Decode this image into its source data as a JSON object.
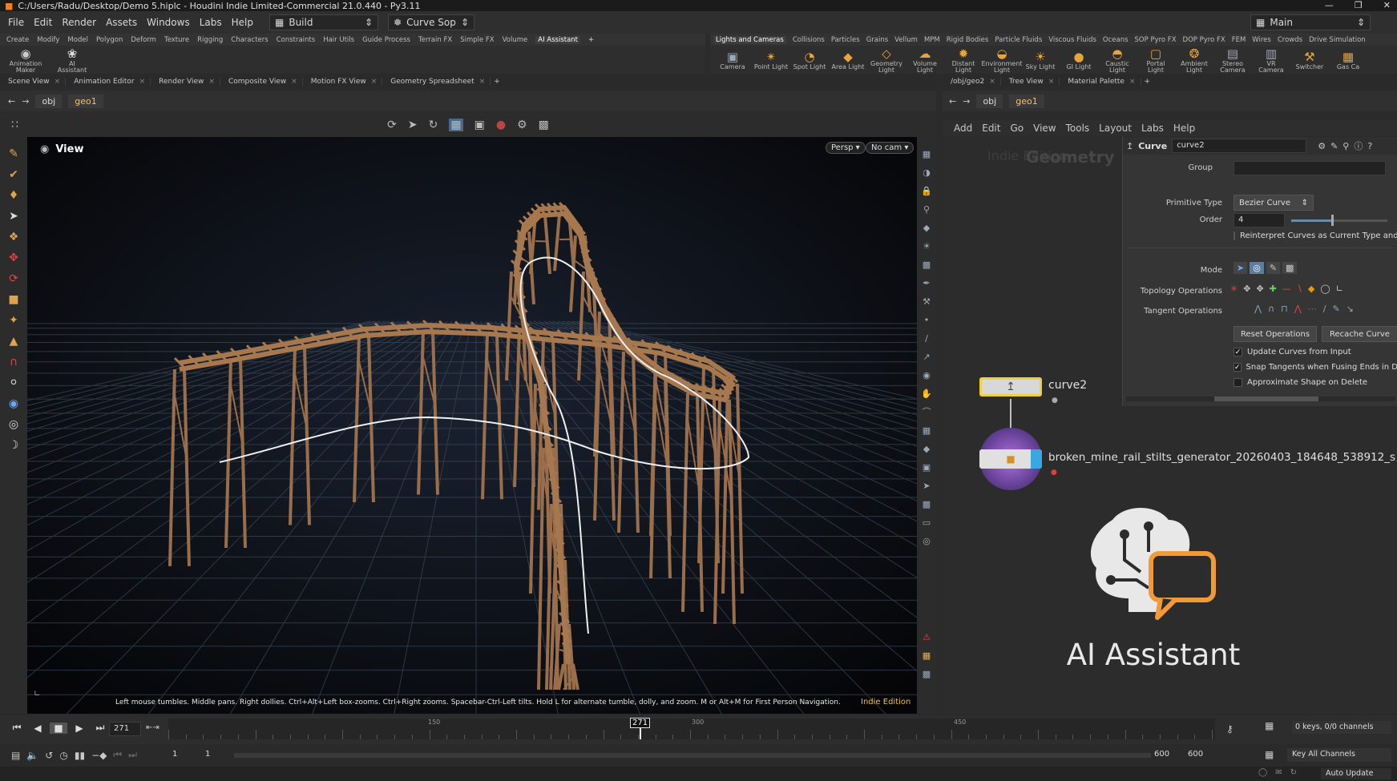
{
  "window": {
    "title": "C:/Users/Radu/Desktop/Demo 5.hiplc - Houdini Indie Limited-Commercial 21.0.440 - Py3.11"
  },
  "menubar": {
    "items": [
      "File",
      "Edit",
      "Render",
      "Assets",
      "Windows",
      "Labs",
      "Help"
    ],
    "desktop": "Build",
    "context": "Curve Sop",
    "main_desktop": "Main"
  },
  "shelf_tabs_left": [
    "Create",
    "Modify",
    "Model",
    "Polygon",
    "Deform",
    "Texture",
    "Rigging",
    "Characters",
    "Constraints",
    "Hair Utils",
    "Guide Process",
    "Terrain FX",
    "Simple FX",
    "Volume",
    "AI Assistant"
  ],
  "shelf_tabs_right": [
    "Lights and Cameras",
    "Collisions",
    "Particles",
    "Grains",
    "Vellum",
    "MPM",
    "Rigid Bodies",
    "Particle Fluids",
    "Viscous Fluids",
    "Oceans",
    "SOP Pyro FX",
    "DOP Pyro FX",
    "FEM",
    "Wires",
    "Crowds",
    "Drive Simulation"
  ],
  "shelf_tools_left": [
    "Animation Maker",
    "AI Assistant"
  ],
  "shelf_tools_right": [
    "Camera",
    "Point Light",
    "Spot Light",
    "Area Light",
    "Geometry Light",
    "Volume Light",
    "Distant Light",
    "Environment Light",
    "Sky Light",
    "GI Light",
    "Caustic Light",
    "Portal Light",
    "Ambient Light",
    "Stereo Camera",
    "VR Camera",
    "Switcher",
    "Gas Ca"
  ],
  "pane_tabs_left": [
    "Scene View",
    "Animation Editor",
    "Render View",
    "Composite View",
    "Motion FX View",
    "Geometry Spreadsheet"
  ],
  "pane_tabs_right": [
    "/obj/geo2",
    "Tree View",
    "Material Palette"
  ],
  "path_left": {
    "obj": "obj",
    "node": "geo1"
  },
  "path_right": {
    "obj": "obj",
    "node": "geo1"
  },
  "viewport": {
    "label": "View",
    "persp": "Persp ▾",
    "cam": "No cam ▾",
    "hint": "Left mouse tumbles. Middle pans. Right dollies. Ctrl+Alt+Left box-zooms. Ctrl+Right zooms. Spacebar-Ctrl-Left tilts. Hold L for alternate tumble, dolly, and zoom. M or Alt+M for First Person Navigation.",
    "edition": "Indie Edition"
  },
  "network_menu": [
    "Add",
    "Edit",
    "Go",
    "View",
    "Tools",
    "Layout",
    "Labs",
    "Help"
  ],
  "network": {
    "watermark_indie": "Indie Edition",
    "watermark_geo": "Geometry",
    "node1": "curve2",
    "node2": "broken_mine_rail_stilts_generator_20260403_184648_538912_s",
    "ai_label": "AI Assistant"
  },
  "params": {
    "type": "Curve",
    "name": "curve2",
    "group_label": "Group",
    "prim_label": "Primitive Type",
    "prim_value": "Bezier Curve",
    "order_label": "Order",
    "order_value": "4",
    "reinterpret": "Reinterpret Curves as Current Type and",
    "mode_label": "Mode",
    "topo_label": "Topology Operations",
    "tangent_label": "Tangent Operations",
    "reset_btn": "Reset Operations",
    "recache_btn": "Recache Curve",
    "chk1": "Update Curves from Input",
    "chk2": "Snap Tangents when Fusing Ends in Dr",
    "chk3": "Approximate Shape on Delete"
  },
  "timeline": {
    "frame": "271",
    "marker": "271",
    "tick150": "150",
    "tick300": "300",
    "tick450": "450",
    "keys": "0 keys, 0/0 channels",
    "key_all": "Key All Channels"
  },
  "range": {
    "start": "1",
    "start2": "1",
    "end": "600",
    "end2": "600"
  },
  "status": {
    "auto_update": "Auto Update"
  }
}
